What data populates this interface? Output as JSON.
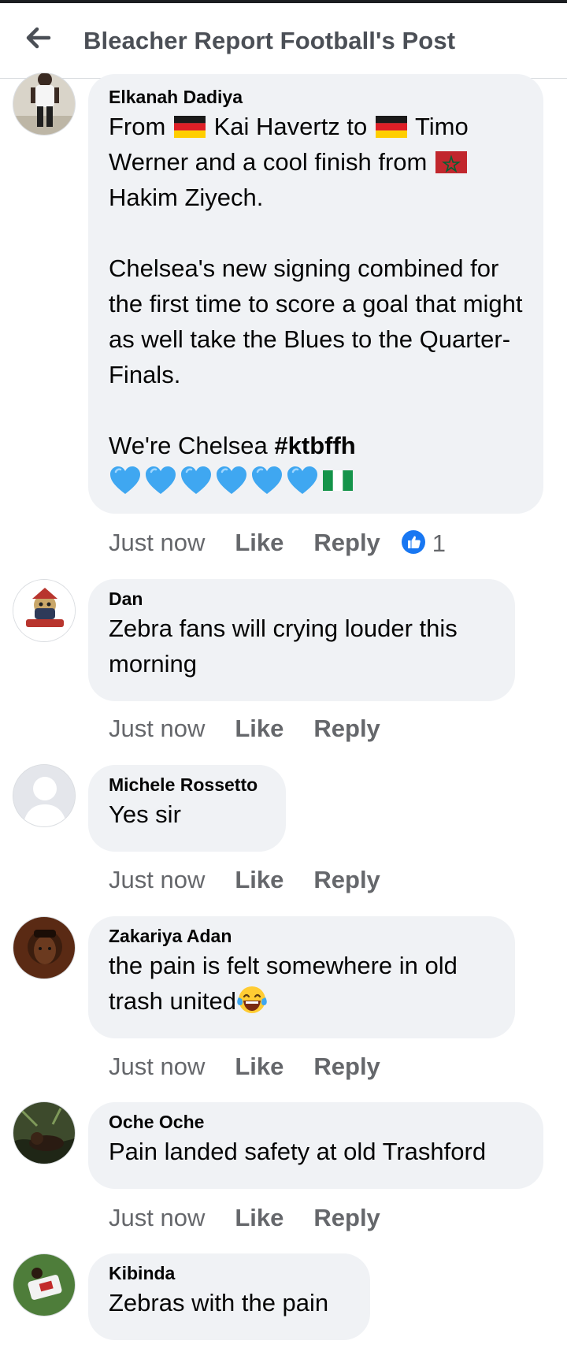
{
  "header": {
    "title": "Bleacher Report Football's Post"
  },
  "comments": [
    {
      "author": "Elkanah Dadiya",
      "text_part1": "From",
      "text_part2": "Kai Havertz to",
      "text_part3": "Timo Werner and a cool finish from",
      "text_part4": "Hakim Ziyech.",
      "paragraph2": "Chelsea's new signing combined for the first time to score a goal that might as well take the Blues to the Quarter-Finals.",
      "paragraph3_text": "We're Chelsea ",
      "paragraph3_hashtag": "#ktbffh",
      "time": "Just now",
      "like": "Like",
      "reply": "Reply",
      "reaction_count": "1"
    },
    {
      "author": "Dan",
      "text": "Zebra fans will crying louder this morning",
      "time": "Just now",
      "like": "Like",
      "reply": "Reply"
    },
    {
      "author": "Michele Rossetto",
      "text": "Yes sir",
      "time": "Just now",
      "like": "Like",
      "reply": "Reply"
    },
    {
      "author": "Zakariya Adan",
      "text": "the pain is felt somewhere in old trash united",
      "time": "Just now",
      "like": "Like",
      "reply": "Reply"
    },
    {
      "author": "Oche Oche",
      "text": "Pain landed safety at old Trashford",
      "time": "Just now",
      "like": "Like",
      "reply": "Reply"
    },
    {
      "author": "Kibinda",
      "text": "Zebras with the pain"
    }
  ],
  "icons": {
    "back": "arrow-left-icon",
    "like_reaction": "thumbs-up-icon",
    "germany_flag": "germany-flag-icon",
    "morocco_flag": "morocco-flag-icon",
    "nigeria_flag": "nigeria-flag-icon",
    "blue_heart": "blue-heart-icon",
    "laughing_emoji": "tears-of-joy-icon"
  },
  "colors": {
    "bubble": "#f0f2f5",
    "action_text": "#65676b",
    "like_blue": "#1877f2",
    "header_text": "#4b4f56"
  }
}
